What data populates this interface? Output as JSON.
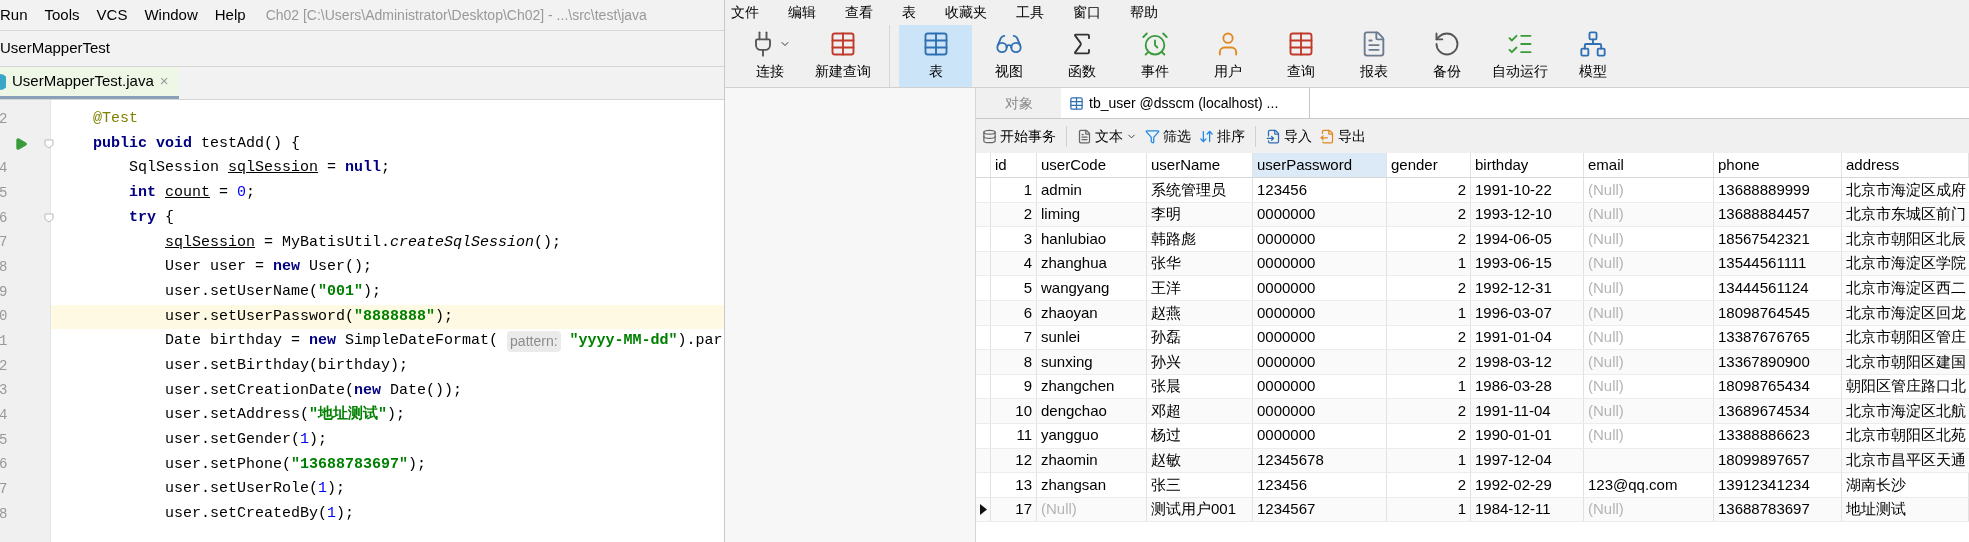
{
  "ide": {
    "menu": [
      "Run",
      "Tools",
      "VCS",
      "Window",
      "Help"
    ],
    "title": "Ch02 [C:\\Users\\Administrator\\Desktop\\Ch02] - ...\\src\\test\\java",
    "breadcrumb": "UserMapperTest",
    "tab": {
      "label": "UserMapperTest.java",
      "close": "×",
      "selected": true
    },
    "lines": [
      {
        "number": "2",
        "run": false,
        "fold": false,
        "current": false,
        "tokens": [
          {
            "kind": "ann",
            "text": "@Test"
          }
        ]
      },
      {
        "run": true,
        "fold": true,
        "current": false,
        "tokens": [
          {
            "kind": "kw",
            "text": "public void "
          },
          {
            "kind": "plain",
            "text": "testAdd() {"
          }
        ],
        "children": [
          {
            "number": "4",
            "run": false,
            "fold": false,
            "current": false,
            "tokens": [
              {
                "kind": "plain",
                "text": "SqlSession "
              },
              {
                "kind": "ul",
                "text": "sqlSession"
              },
              {
                "kind": "plain",
                "text": " = "
              },
              {
                "kind": "kw",
                "text": "null"
              },
              {
                "kind": "plain",
                "text": ";"
              }
            ]
          },
          {
            "number": "5",
            "run": false,
            "fold": false,
            "current": false,
            "tokens": [
              {
                "kind": "kw",
                "text": "int "
              },
              {
                "kind": "ul",
                "text": "count"
              },
              {
                "kind": "plain",
                "text": " = "
              },
              {
                "kind": "num",
                "text": "0"
              },
              {
                "kind": "plain",
                "text": ";"
              }
            ]
          },
          {
            "number": "6",
            "run": false,
            "fold": true,
            "current": false,
            "tokens": [
              {
                "kind": "kw",
                "text": "try "
              },
              {
                "kind": "plain",
                "text": "{"
              }
            ],
            "children": [
              {
                "number": "7",
                "run": false,
                "fold": false,
                "current": false,
                "tokens": [
                  {
                    "kind": "ul",
                    "text": "sqlSession"
                  },
                  {
                    "kind": "plain",
                    "text": " = MyBatisUtil."
                  },
                  {
                    "kind": "ital",
                    "text": "createSqlSession"
                  },
                  {
                    "kind": "plain",
                    "text": "();"
                  }
                ]
              },
              {
                "number": "8",
                "run": false,
                "fold": false,
                "current": false,
                "tokens": [
                  {
                    "kind": "plain",
                    "text": "User user = "
                  },
                  {
                    "kind": "kw",
                    "text": "new "
                  },
                  {
                    "kind": "plain",
                    "text": "User();"
                  }
                ]
              },
              {
                "number": "9",
                "run": false,
                "fold": false,
                "current": false,
                "tokens": [
                  {
                    "kind": "plain",
                    "text": "user.setUserName("
                  },
                  {
                    "kind": "str",
                    "text": "\"001\""
                  },
                  {
                    "kind": "plain",
                    "text": ");"
                  }
                ]
              },
              {
                "number": "0",
                "run": false,
                "fold": false,
                "current": true,
                "tokens": [
                  {
                    "kind": "plain",
                    "text": "user.setUserPassword("
                  },
                  {
                    "kind": "str",
                    "text": "\"8888888\""
                  },
                  {
                    "kind": "plain",
                    "text": ");"
                  }
                ]
              },
              {
                "number": "1",
                "run": false,
                "fold": false,
                "current": false,
                "tokens": [
                  {
                    "kind": "plain",
                    "text": "Date birthday = "
                  },
                  {
                    "kind": "kw",
                    "text": "new "
                  },
                  {
                    "kind": "plain",
                    "text": "SimpleDateFormat( "
                  },
                  {
                    "kind": "hint",
                    "text": "pattern:"
                  },
                  {
                    "kind": "str",
                    "text": " \"yyyy-MM-dd\""
                  },
                  {
                    "kind": "plain",
                    "text": ").par"
                  }
                ]
              },
              {
                "number": "2",
                "run": false,
                "fold": false,
                "current": false,
                "tokens": [
                  {
                    "kind": "plain",
                    "text": "user.setBirthday(birthday);"
                  }
                ]
              },
              {
                "number": "3",
                "run": false,
                "fold": false,
                "current": false,
                "tokens": [
                  {
                    "kind": "plain",
                    "text": "user.setCreationDate("
                  },
                  {
                    "kind": "kw",
                    "text": "new "
                  },
                  {
                    "kind": "plain",
                    "text": "Date());"
                  }
                ]
              },
              {
                "number": "4",
                "run": false,
                "fold": false,
                "current": false,
                "tokens": [
                  {
                    "kind": "plain",
                    "text": "user.setAddress("
                  },
                  {
                    "kind": "str",
                    "text": "\"地址测试\""
                  },
                  {
                    "kind": "plain",
                    "text": ");"
                  }
                ]
              },
              {
                "number": "5",
                "run": false,
                "fold": false,
                "current": false,
                "tokens": [
                  {
                    "kind": "plain",
                    "text": "user.setGender("
                  },
                  {
                    "kind": "num",
                    "text": "1"
                  },
                  {
                    "kind": "plain",
                    "text": ");"
                  }
                ]
              },
              {
                "number": "6",
                "run": false,
                "fold": false,
                "current": false,
                "tokens": [
                  {
                    "kind": "plain",
                    "text": "user.setPhone("
                  },
                  {
                    "kind": "str",
                    "text": "\"13688783697\""
                  },
                  {
                    "kind": "plain",
                    "text": ");"
                  }
                ]
              },
              {
                "number": "7",
                "run": false,
                "fold": false,
                "current": false,
                "tokens": [
                  {
                    "kind": "plain",
                    "text": "user.setUserRole("
                  },
                  {
                    "kind": "num",
                    "text": "1"
                  },
                  {
                    "kind": "plain",
                    "text": ");"
                  }
                ]
              },
              {
                "number": "8",
                "run": false,
                "fold": false,
                "current": false,
                "tokens": [
                  {
                    "kind": "plain",
                    "text": "user.setCreatedBy("
                  },
                  {
                    "kind": "num",
                    "text": "1"
                  },
                  {
                    "kind": "plain",
                    "text": ");"
                  }
                ]
              }
            ]
          }
        ]
      }
    ]
  },
  "navicat": {
    "menu": [
      "文件",
      "编辑",
      "查看",
      "表",
      "收藏夹",
      "工具",
      "窗口",
      "帮助"
    ],
    "toolbar": [
      [
        {
          "label": "连接",
          "kind": "plug",
          "selected": false,
          "dropdown": true
        },
        {
          "label": "新建查询",
          "kind": "query",
          "selected": false,
          "dropdown": false
        }
      ],
      [
        {
          "label": "表",
          "kind": "table",
          "selected": true,
          "dropdown": false
        },
        {
          "label": "视图",
          "kind": "view",
          "selected": false,
          "dropdown": false
        },
        {
          "label": "函数",
          "kind": "function",
          "selected": false,
          "dropdown": false
        },
        {
          "label": "事件",
          "kind": "clock",
          "selected": false,
          "dropdown": false
        },
        {
          "label": "用户",
          "kind": "user",
          "selected": false,
          "dropdown": false
        },
        {
          "label": "查询",
          "kind": "query",
          "selected": false,
          "dropdown": false
        },
        {
          "label": "报表",
          "kind": "report",
          "selected": false,
          "dropdown": false
        },
        {
          "label": "备份",
          "kind": "backup",
          "selected": false,
          "dropdown": false
        },
        {
          "label": "自动运行",
          "kind": "schedule",
          "selected": false,
          "dropdown": false
        },
        {
          "label": "模型",
          "kind": "model",
          "selected": false,
          "dropdown": false
        }
      ]
    ],
    "tabs": [
      {
        "label": "对象",
        "selected": false
      },
      {
        "label": "tb_user @dsscm (localhost) ...",
        "selected": true
      }
    ],
    "actions": [
      [
        {
          "label": "开始事务",
          "kind": "database",
          "dropdown": false
        }
      ],
      [
        {
          "label": "文本",
          "kind": "text",
          "dropdown": true
        },
        {
          "label": "筛选",
          "kind": "filter",
          "dropdown": false
        },
        {
          "label": "排序",
          "kind": "sort",
          "dropdown": false
        }
      ],
      [
        {
          "label": "导入",
          "kind": "import",
          "dropdown": false
        },
        {
          "label": "导出",
          "kind": "export",
          "dropdown": false
        }
      ]
    ],
    "table": {
      "columns": [
        {
          "label": "id",
          "selected": false
        },
        {
          "label": "userCode",
          "selected": false
        },
        {
          "label": "userName",
          "selected": false
        },
        {
          "label": "userPassword",
          "selected": true
        },
        {
          "label": "gender",
          "selected": false
        },
        {
          "label": "birthday",
          "selected": false
        },
        {
          "label": "email",
          "selected": false
        },
        {
          "label": "phone",
          "selected": false
        },
        {
          "label": "address",
          "selected": false
        }
      ],
      "rows": [
        {
          "selected": false,
          "cells": [
            "1",
            "admin",
            "系统管理员",
            "123456",
            "2",
            "1991-10-22",
            {
              "null": "(Null)"
            },
            "13688889999",
            "北京市海淀区成府"
          ]
        },
        {
          "selected": false,
          "cells": [
            "2",
            "liming",
            "李明",
            "0000000",
            "2",
            "1993-12-10",
            {
              "null": "(Null)"
            },
            "13688884457",
            "北京市东城区前门"
          ]
        },
        {
          "selected": false,
          "cells": [
            "3",
            "hanlubiao",
            "韩路彪",
            "0000000",
            "2",
            "1994-06-05",
            {
              "null": "(Null)"
            },
            "18567542321",
            "北京市朝阳区北辰"
          ]
        },
        {
          "selected": false,
          "cells": [
            "4",
            "zhanghua",
            "张华",
            "0000000",
            "1",
            "1993-06-15",
            {
              "null": "(Null)"
            },
            "13544561111",
            "北京市海淀区学院"
          ]
        },
        {
          "selected": false,
          "cells": [
            "5",
            "wangyang",
            "王洋",
            "0000000",
            "2",
            "1992-12-31",
            {
              "null": "(Null)"
            },
            "13444561124",
            "北京市海淀区西二"
          ]
        },
        {
          "selected": false,
          "cells": [
            "6",
            "zhaoyan",
            "赵燕",
            "0000000",
            "1",
            "1996-03-07",
            {
              "null": "(Null)"
            },
            "18098764545",
            "北京市海淀区回龙"
          ]
        },
        {
          "selected": false,
          "cells": [
            "7",
            "sunlei",
            "孙磊",
            "0000000",
            "2",
            "1991-01-04",
            {
              "null": "(Null)"
            },
            "13387676765",
            "北京市朝阳区管庄"
          ]
        },
        {
          "selected": false,
          "cells": [
            "8",
            "sunxing",
            "孙兴",
            "0000000",
            "2",
            "1998-03-12",
            {
              "null": "(Null)"
            },
            "13367890900",
            "北京市朝阳区建国"
          ]
        },
        {
          "selected": false,
          "cells": [
            "9",
            "zhangchen",
            "张晨",
            "0000000",
            "1",
            "1986-03-28",
            {
              "null": "(Null)"
            },
            "18098765434",
            "朝阳区管庄路口北"
          ]
        },
        {
          "selected": false,
          "cells": [
            "10",
            "dengchao",
            "邓超",
            "0000000",
            "2",
            "1991-11-04",
            {
              "null": "(Null)"
            },
            "13689674534",
            "北京市海淀区北航"
          ]
        },
        {
          "selected": false,
          "cells": [
            "11",
            "yangguo",
            "杨过",
            "0000000",
            "2",
            "1990-01-01",
            {
              "null": "(Null)"
            },
            "13388886623",
            "北京市朝阳区北苑"
          ]
        },
        {
          "selected": false,
          "cells": [
            "12",
            "zhaomin",
            "赵敏",
            "12345678",
            "1",
            "1997-12-04",
            null,
            "18099897657",
            "北京市昌平区天通"
          ]
        },
        {
          "selected": false,
          "cells": [
            "13",
            "zhangsan",
            "张三",
            "123456",
            "2",
            "1992-02-29",
            "123@qq.com",
            "13912341234",
            "湖南长沙"
          ]
        },
        {
          "selected": true,
          "cells": [
            "17",
            {
              "null": "(Null)"
            },
            "测试用户001",
            "1234567",
            "1",
            "1984-12-11",
            {
              "null": "(Null)"
            },
            "13688783697",
            "地址测试"
          ]
        }
      ]
    }
  }
}
